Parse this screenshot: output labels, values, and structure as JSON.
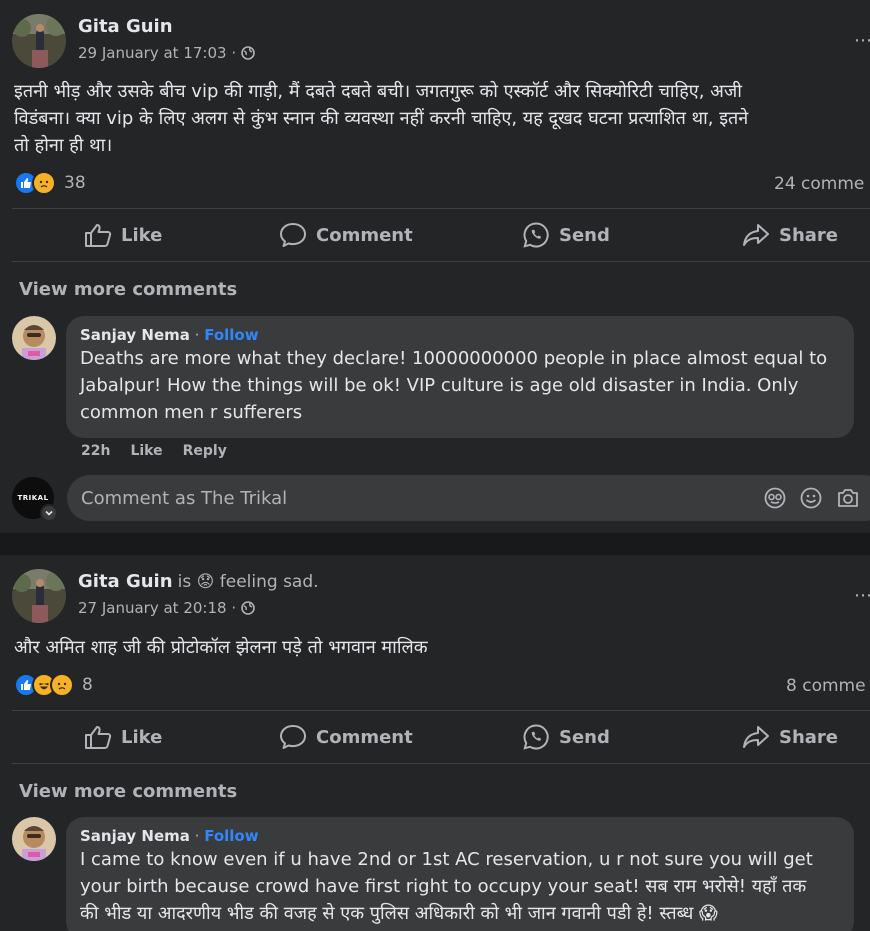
{
  "colors": {
    "background": "#18191a",
    "card": "#242526",
    "bubble": "#3a3b3c",
    "link": "#2d88ff",
    "text": "#e4e6eb",
    "muted": "#b0b3b8",
    "like": "#1877f2",
    "sad": "#f7b125"
  },
  "posts": [
    {
      "author": "Gita Guin",
      "feeling": "",
      "timestamp": "29 January at 17:03 ·",
      "text_lines": [
        "इतनी भीड़ और उसके बीच vip की गाड़ी, मैं दबते दबते बची। जगतगुरू को एस्कॉर्ट और सिक्योरिटी चाहिए, अजी",
        "विडंबना। क्या vip के लिए अलग से कुंभ स्नान की व्यवस्था नहीं करनी चाहिए, यह दूखद घटना प्रत्याशित था, इतने",
        "तो होना ही था।"
      ],
      "reaction_icons": [
        "like-reaction-icon",
        "sad-reaction-icon"
      ],
      "reaction_count": "38",
      "comment_count": "24 comme",
      "actions": {
        "like": "Like",
        "comment": "Comment",
        "send": "Send",
        "share": "Share"
      },
      "view_more": "View more comments",
      "comment": {
        "name": "Sanjay Nema",
        "sep": " · ",
        "follow": "Follow",
        "text_lines": [
          "Deaths are more what they declare! 10000000000 people in place almost equal to",
          "Jabalpur! How the things will be ok! VIP culture is age old disaster in India. Only",
          "common men r sufferers"
        ],
        "age": "22h",
        "like": "Like",
        "reply": "Reply"
      },
      "composer": {
        "placeholder": "Comment as The Trikal",
        "avatar_text": "TRIKAL"
      }
    },
    {
      "author": "Gita Guin",
      "feeling": "is 😟 feeling sad.",
      "timestamp": "27 January at 20:18 ·",
      "text_lines": [
        "और अमित शाह जी की प्रोटोकॉल झेलना पड़े तो भगवान मालिक"
      ],
      "reaction_icons": [
        "like-reaction-icon",
        "haha-reaction-icon",
        "sad-reaction-icon"
      ],
      "reaction_count": "8",
      "comment_count": "8 comme",
      "actions": {
        "like": "Like",
        "comment": "Comment",
        "send": "Send",
        "share": "Share"
      },
      "view_more": "View more comments",
      "comment": {
        "name": "Sanjay Nema",
        "sep": " · ",
        "follow": "Follow",
        "text_lines": [
          "I came to know even if u have 2nd or 1st AC reservation, u r not sure you will get",
          "your birth because crowd have first right to occupy your seat! सब राम भरोसे! यहाँ तक",
          "की भीड या आदरणीय भीड की वजह से एक पुलिस अधिकारी को भी जान गवानी पडी हे! स्तब्ध 😱"
        ]
      }
    }
  ]
}
